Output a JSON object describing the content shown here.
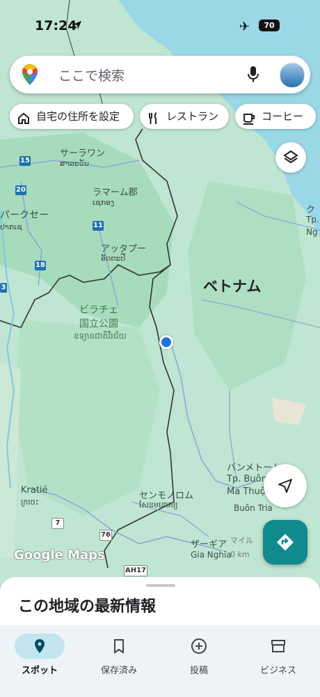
{
  "status_bar": {
    "time": "17:24",
    "battery": "70"
  },
  "search": {
    "placeholder": "ここで検索"
  },
  "chips": [
    {
      "label": "自宅の住所を設定",
      "icon": "home-icon"
    },
    {
      "label": "レストラン",
      "icon": "fork-knife-icon"
    },
    {
      "label": "コーヒー",
      "icon": "coffee-cup-icon"
    }
  ],
  "map": {
    "labels": {
      "saravan": "サーラワン",
      "saravan_lo": "ສາລະວັນ",
      "lamam": "ラマーム郡",
      "lamam_lo": "ເຊກອງ",
      "pakse": "パークセー",
      "pakse_lo": "ປາກເຊ",
      "attapeu": "アッタプー",
      "attapeu_lo": "ອັດຕະປື",
      "vietnam": "ベトナム",
      "virachey1": "ビラチェ",
      "virachey2": "国立公園",
      "virachey_km": "ឧទ្យានជាតិវីរជ័យ",
      "kratie": "Kratié",
      "kratie_km": "ក្រចេះ",
      "senmonorom": "センモノロム",
      "senmonorom_km": "សែនមនោរម្យ",
      "banmethuot": "バンメトート",
      "buon1": "Tp. Buôn",
      "buon2": "Ma Thuột",
      "buontria": "Buôn Tria",
      "gianghia1": "ザーギア",
      "gianghia2": "Gia Nghĩa",
      "qu": "ク",
      "tp": "Tp.",
      "ng": "Ng"
    },
    "road_shields": [
      "15",
      "20",
      "11",
      "18",
      "3",
      "7",
      "76"
    ],
    "ah_shield": "AH17",
    "scale_text": "マイル",
    "scale_km": "0 km",
    "watermark": "Google Maps"
  },
  "sheet": {
    "title": "この地域の最新情報"
  },
  "bottom_nav": [
    {
      "label": "スポット",
      "icon": "location-pin-icon",
      "active": true
    },
    {
      "label": "保存済み",
      "icon": "bookmark-icon",
      "active": false
    },
    {
      "label": "投稿",
      "icon": "add-circle-icon",
      "active": false
    },
    {
      "label": "ビジネス",
      "icon": "storefront-icon",
      "active": false
    }
  ]
}
